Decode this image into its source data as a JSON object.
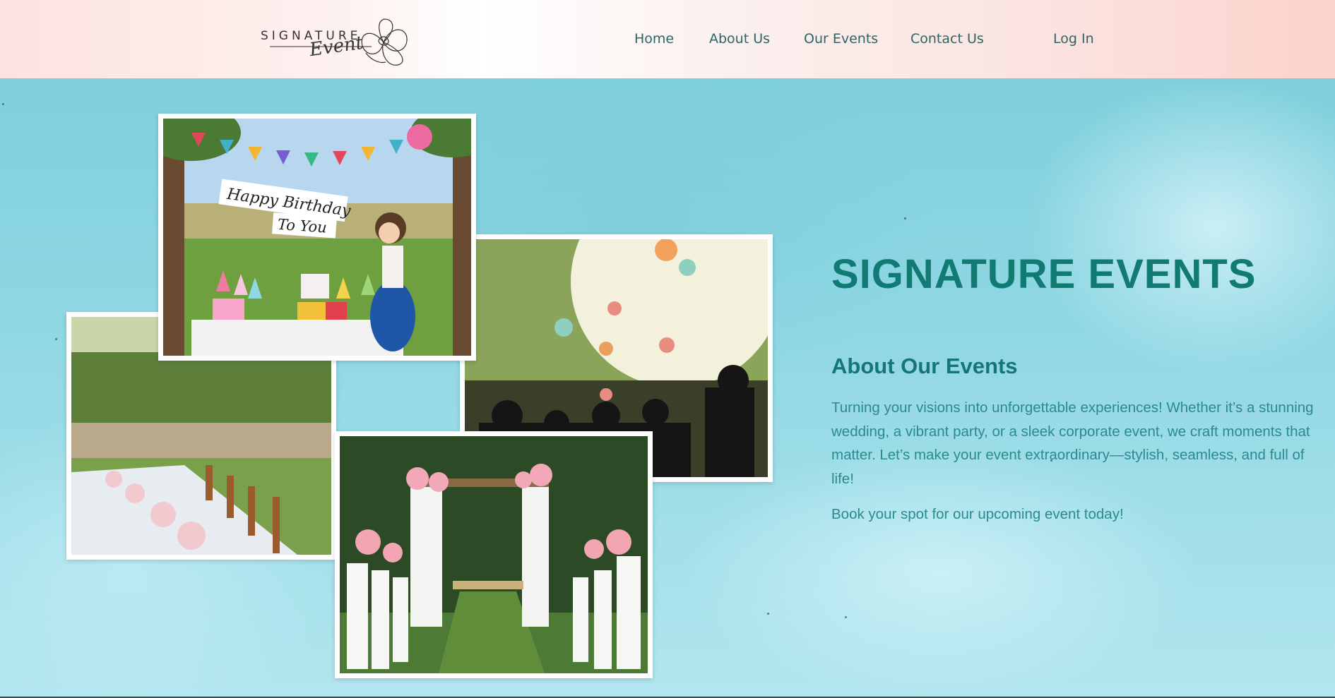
{
  "header": {
    "logo": {
      "word": "SIGNATURE",
      "script": "Event",
      "icon": "rose-flower-icon"
    },
    "nav": [
      {
        "label": "Home"
      },
      {
        "label": "About Us"
      },
      {
        "label": "Our Events"
      },
      {
        "label": "Contact Us"
      }
    ],
    "login_label": "Log In"
  },
  "hero": {
    "title": "SIGNATURE EVENTS",
    "about_heading": "About Our Events",
    "about_text": "Turning your visions into unforgettable experiences! Whether it’s a stunning wedding, a vibrant party, or a sleek corporate event, we craft moments that matter. Let’s make your event extraordinary—stylish, seamless, and full of life!",
    "cta_text": "Book your spot for our upcoming event today!",
    "gallery": {
      "birthday_banner_line1": "Happy Birthday",
      "birthday_banner_line2": "To  You"
    }
  },
  "colors": {
    "title": "#117a73",
    "body_text": "#2b8a8c",
    "nav_text": "#2f6467",
    "hero_bg": "#8fd7e3",
    "header_bg": "#fbe2de"
  }
}
